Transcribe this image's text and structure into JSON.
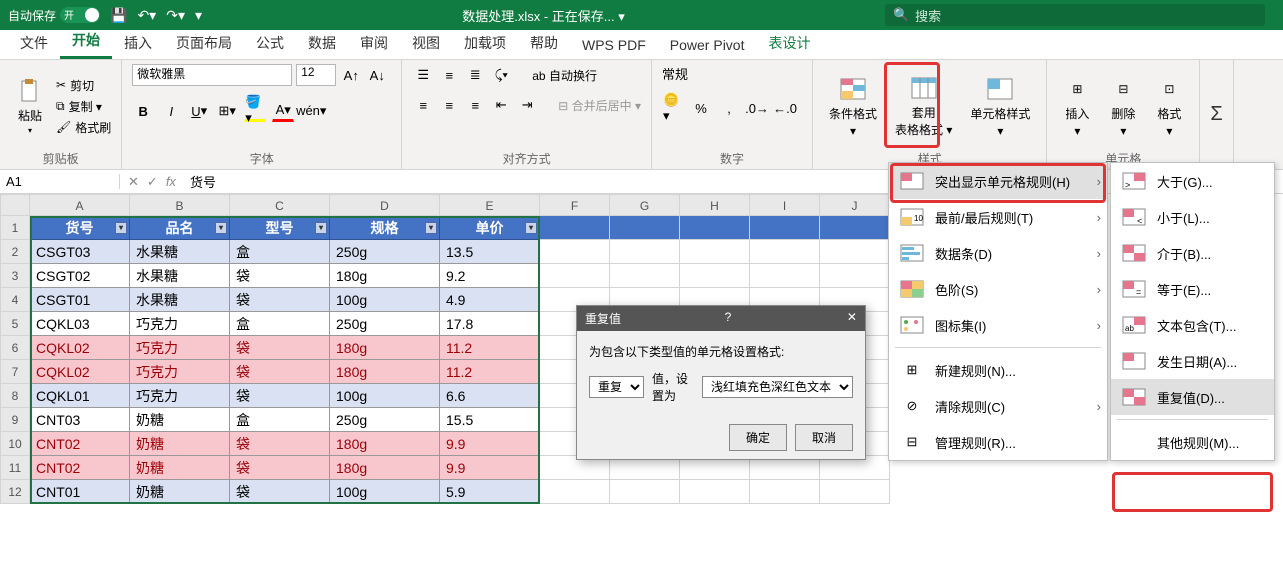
{
  "titlebar": {
    "autosave_label": "自动保存",
    "autosave_on": "开",
    "doc_name": "数据处理.xlsx - 正在保存... ▾",
    "search_placeholder": "搜索"
  },
  "tabs": {
    "file": "文件",
    "home": "开始",
    "insert": "插入",
    "layout": "页面布局",
    "formulas": "公式",
    "data": "数据",
    "review": "审阅",
    "view": "视图",
    "addins": "加载项",
    "help": "帮助",
    "wps": "WPS PDF",
    "power": "Power Pivot",
    "design": "表设计"
  },
  "ribbon": {
    "clipboard": {
      "paste": "粘贴",
      "cut": "剪切",
      "copy": "复制 ▾",
      "brush": "格式刷",
      "label": "剪贴板"
    },
    "font": {
      "name": "微软雅黑",
      "size": "12",
      "label": "字体"
    },
    "align": {
      "wrap": "自动换行",
      "merge": "合并后居中 ▾",
      "label": "对齐方式"
    },
    "number": {
      "format": "常规",
      "label": "数字"
    },
    "styles": {
      "cond": "条件格式",
      "table": "套用\n表格格式 ▾",
      "cell": "单元格样式",
      "label": "样式"
    },
    "cells": {
      "insert": "插入",
      "delete": "删除",
      "format": "格式",
      "label": "单元格"
    }
  },
  "formula_bar": {
    "name": "A1",
    "value": "货号"
  },
  "columns": [
    "A",
    "B",
    "C",
    "D",
    "E",
    "F",
    "G",
    "H",
    "I",
    "J"
  ],
  "headers": [
    "货号",
    "品名",
    "型号",
    "规格",
    "单价"
  ],
  "rows": [
    {
      "cells": [
        "CSGT03",
        "水果糖",
        "盒",
        "250g",
        "13.5"
      ],
      "dup": false,
      "odd": true
    },
    {
      "cells": [
        "CSGT02",
        "水果糖",
        "袋",
        "180g",
        "9.2"
      ],
      "dup": false,
      "odd": false
    },
    {
      "cells": [
        "CSGT01",
        "水果糖",
        "袋",
        "100g",
        "4.9"
      ],
      "dup": false,
      "odd": true
    },
    {
      "cells": [
        "CQKL03",
        "巧克力",
        "盒",
        "250g",
        "17.8"
      ],
      "dup": false,
      "odd": false
    },
    {
      "cells": [
        "CQKL02",
        "巧克力",
        "袋",
        "180g",
        "11.2"
      ],
      "dup": true,
      "odd": true
    },
    {
      "cells": [
        "CQKL02",
        "巧克力",
        "袋",
        "180g",
        "11.2"
      ],
      "dup": true,
      "odd": false
    },
    {
      "cells": [
        "CQKL01",
        "巧克力",
        "袋",
        "100g",
        "6.6"
      ],
      "dup": false,
      "odd": true
    },
    {
      "cells": [
        "CNT03",
        "奶糖",
        "盒",
        "250g",
        "15.5"
      ],
      "dup": false,
      "odd": false
    },
    {
      "cells": [
        "CNT02",
        "奶糖",
        "袋",
        "180g",
        "9.9"
      ],
      "dup": true,
      "odd": true
    },
    {
      "cells": [
        "CNT02",
        "奶糖",
        "袋",
        "180g",
        "9.9"
      ],
      "dup": true,
      "odd": false
    },
    {
      "cells": [
        "CNT01",
        "奶糖",
        "袋",
        "100g",
        "5.9"
      ],
      "dup": false,
      "odd": true
    }
  ],
  "dialog": {
    "title": "重复值",
    "help": "?",
    "prompt": "为包含以下类型值的单元格设置格式:",
    "type_value": "重复",
    "mid": "值，设置为",
    "format_value": "浅红填充色深红色文本",
    "ok": "确定",
    "cancel": "取消"
  },
  "menu1": {
    "highlight": "突出显示单元格规则(H)",
    "top": "最前/最后规则(T)",
    "databars": "数据条(D)",
    "colorscales": "色阶(S)",
    "iconsets": "图标集(I)",
    "new": "新建规则(N)...",
    "clear": "清除规则(C)",
    "manage": "管理规则(R)..."
  },
  "menu2": {
    "gt": "大于(G)...",
    "lt": "小于(L)...",
    "between": "介于(B)...",
    "equal": "等于(E)...",
    "text": "文本包含(T)...",
    "date": "发生日期(A)...",
    "dup": "重复值(D)...",
    "other": "其他规则(M)..."
  }
}
